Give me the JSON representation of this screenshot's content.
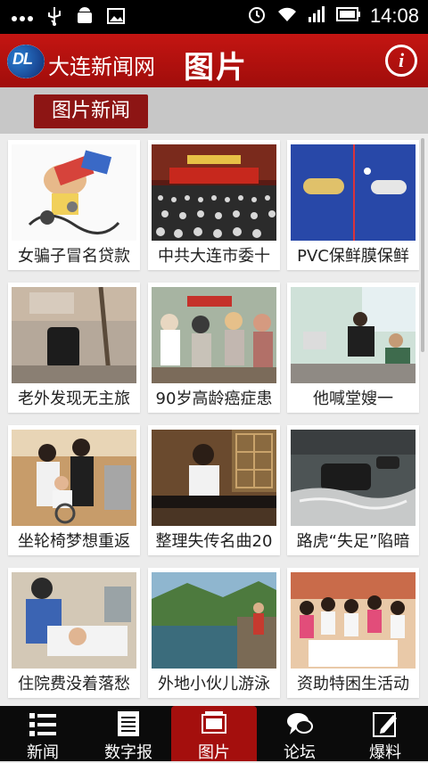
{
  "status": {
    "time": "14:08"
  },
  "app": {
    "site_name": "大连新闻网",
    "page_title": "图片",
    "logo_text": "DL"
  },
  "category_tab": "图片新闻",
  "items": [
    {
      "caption": "女骗子冒名贷款",
      "icon": "cartoon-thumb"
    },
    {
      "caption": "中共大连市委十",
      "icon": "meeting-thumb"
    },
    {
      "caption": "PVC保鲜膜保鲜",
      "icon": "wrap-thumb"
    },
    {
      "caption": "老外发现无主旅",
      "icon": "luggage-thumb"
    },
    {
      "caption": "90岁高龄癌症患",
      "icon": "crowd-thumb"
    },
    {
      "caption": "他喊堂嫂一",
      "icon": "room-thumb"
    },
    {
      "caption": "坐轮椅梦想重返",
      "icon": "wheelchair-thumb"
    },
    {
      "caption": "整理失传名曲20",
      "icon": "guqin-thumb"
    },
    {
      "caption": "路虎“失足”陷暗",
      "icon": "flood-thumb"
    },
    {
      "caption": "住院费没着落愁",
      "icon": "hospital-thumb"
    },
    {
      "caption": "外地小伙儿游泳",
      "icon": "lake-thumb"
    },
    {
      "caption": "资助特困生活动",
      "icon": "students-thumb"
    }
  ],
  "nav": [
    {
      "label": "新闻",
      "icon": "list-icon"
    },
    {
      "label": "数字报",
      "icon": "newspaper-icon"
    },
    {
      "label": "图片",
      "icon": "photo-icon",
      "active": true
    },
    {
      "label": "论坛",
      "icon": "chat-icon"
    },
    {
      "label": "爆料",
      "icon": "edit-icon"
    }
  ],
  "colors": {
    "appbar": "#b31210",
    "active": "#a40f0d",
    "tab": "#8d1514"
  }
}
